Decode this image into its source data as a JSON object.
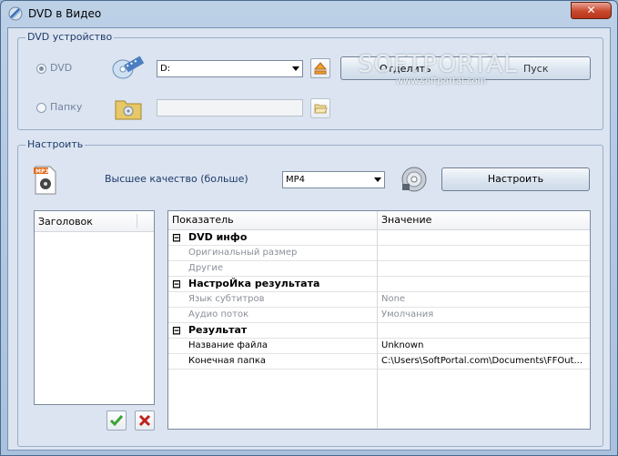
{
  "window": {
    "title": "DVD в Видео",
    "close_glyph": "✕"
  },
  "dvd_group": {
    "title": "DVD устройство",
    "radio_dvd_label": "DVD",
    "radio_folder_label": "Папку",
    "drive_value": "D:",
    "button_eject_label": "Отделить",
    "button_start_label": "Пуск",
    "watermark": "SOFTPORTAL",
    "watermark_url": "www.softportal.com"
  },
  "settings_group": {
    "title": "Настроить",
    "quality_label": "Высшее качество (больше)",
    "format_value": "MP4",
    "button_configure_label": "Настроить",
    "file_badge": "MP3"
  },
  "titles_list": {
    "header": "Заголовок"
  },
  "properties": {
    "col_name": "Показатель",
    "col_value": "Значение",
    "rows": [
      {
        "type": "section",
        "name": "DVD инфо",
        "value": ""
      },
      {
        "type": "item",
        "name": "Оригинальный размер",
        "value": "",
        "dim": true
      },
      {
        "type": "item",
        "name": "Другие",
        "value": "",
        "dim": true
      },
      {
        "type": "section",
        "name": "НастроЙка результата",
        "value": ""
      },
      {
        "type": "item",
        "name": "Язык субтитров",
        "value": "None",
        "dim": true
      },
      {
        "type": "item",
        "name": "Аудио поток",
        "value": "Умолчания",
        "dim": true
      },
      {
        "type": "section",
        "name": "Результат",
        "value": ""
      },
      {
        "type": "item",
        "name": "Название файла",
        "value": "Unknown",
        "dim": false
      },
      {
        "type": "item",
        "name": "Конечная папка",
        "value": "C:\\Users\\SoftPortal.com\\Documents\\FFOut...",
        "dim": false
      }
    ]
  },
  "colors": {
    "accent": "#1f3a6b",
    "window_bg": "#dbe4f0",
    "ok": "#3aa335",
    "cancel": "#c0221a"
  }
}
